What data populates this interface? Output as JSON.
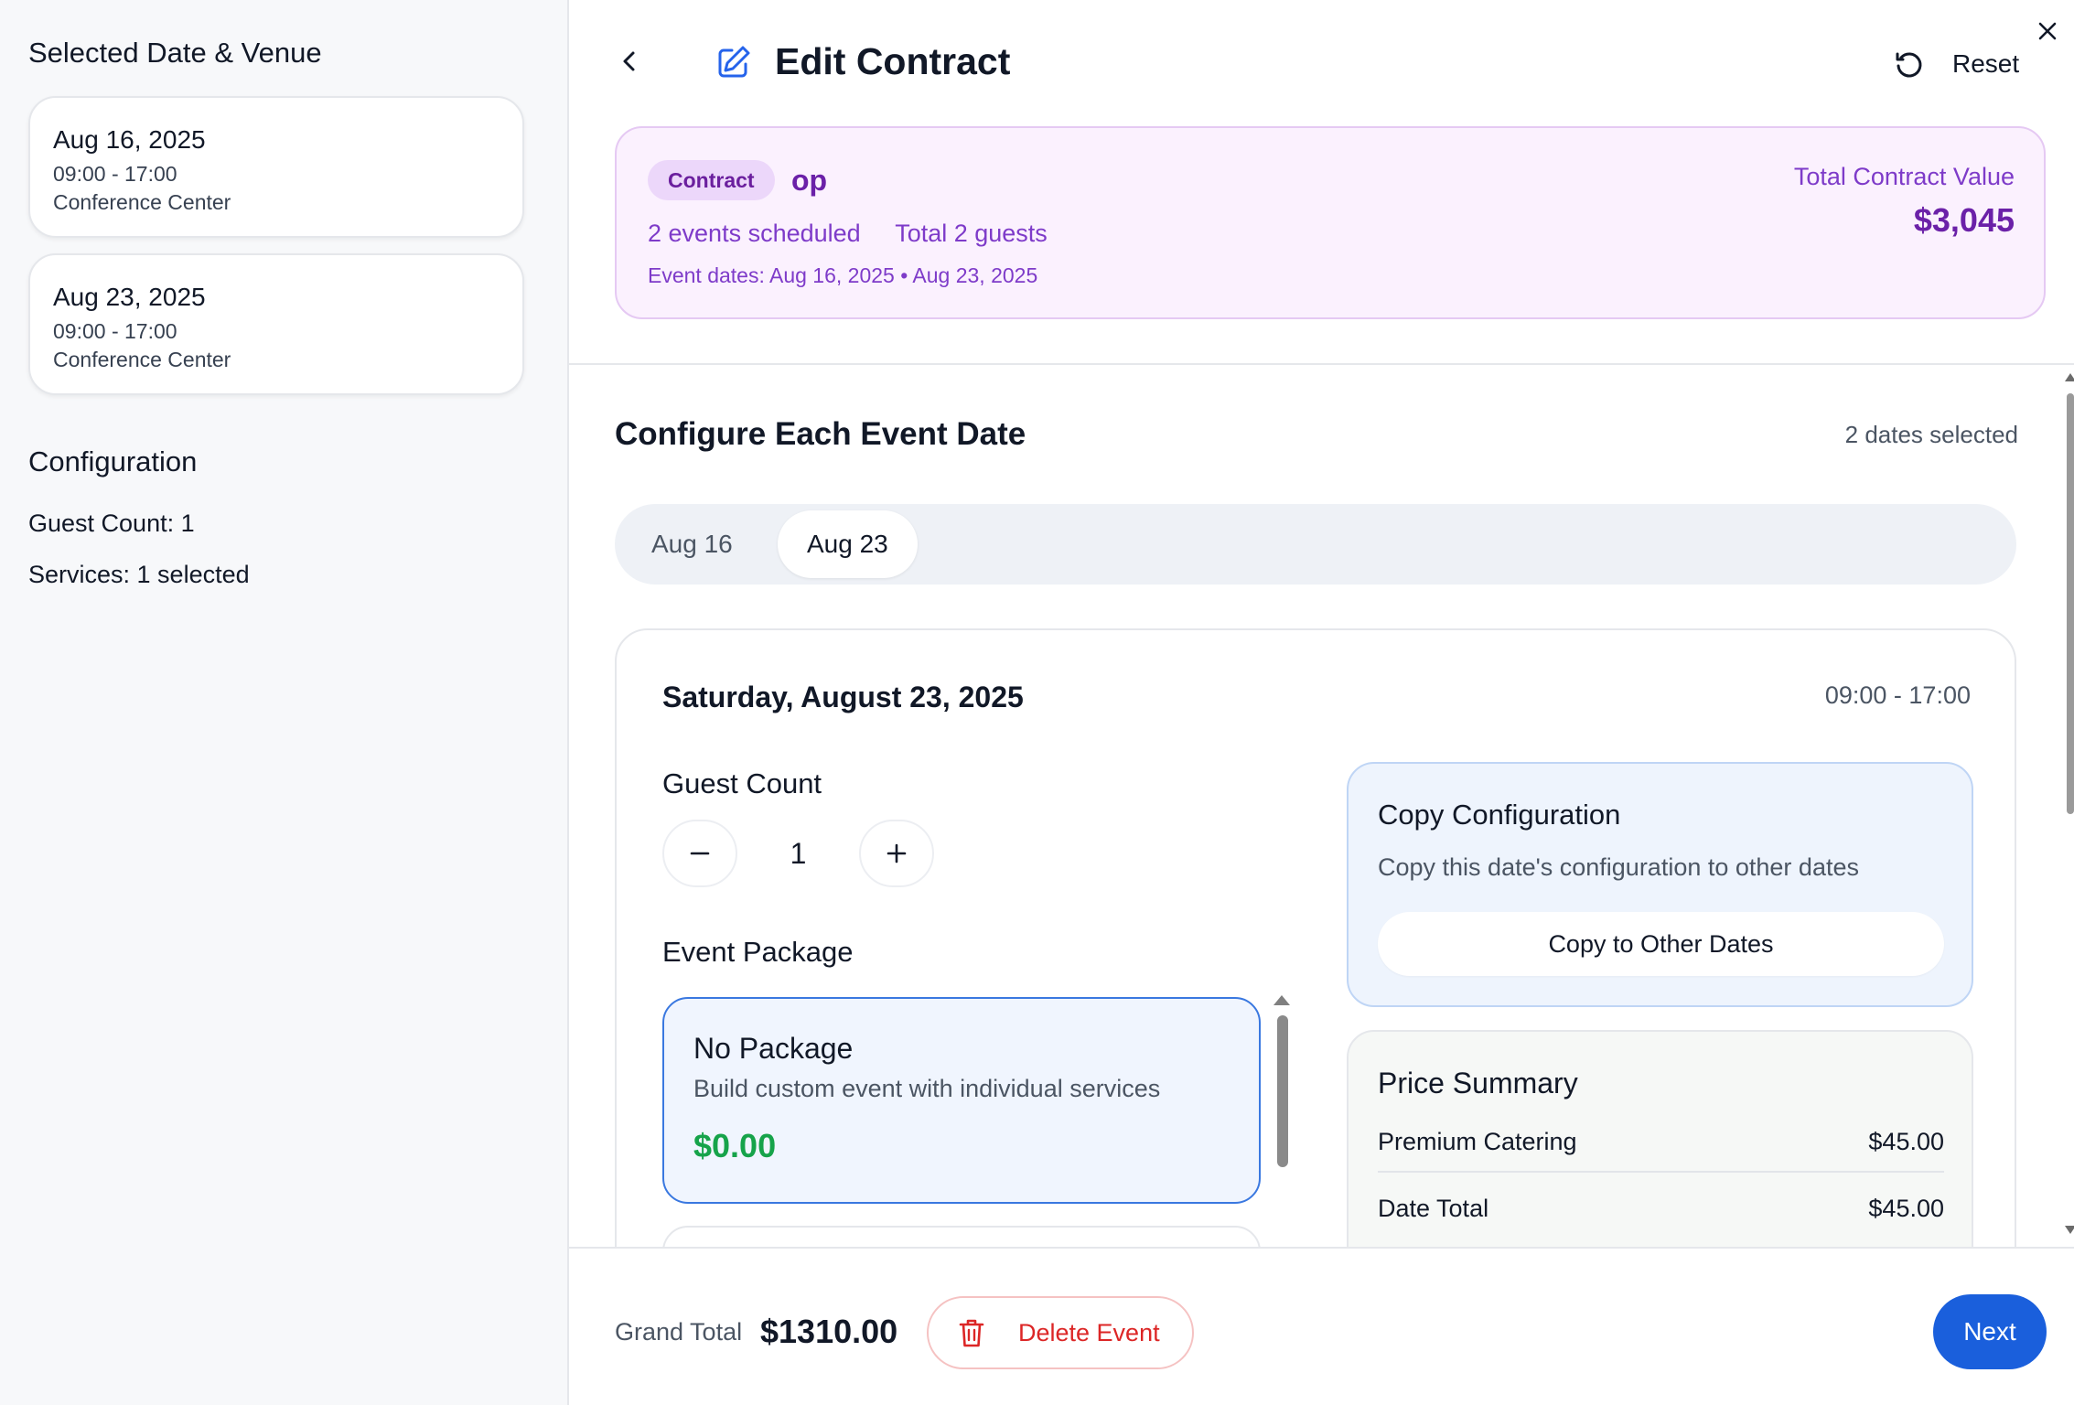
{
  "sidebar": {
    "title": "Selected Date & Venue",
    "dates": [
      {
        "date": "Aug 16, 2025",
        "time": "09:00 - 17:00",
        "venue": "Conference Center"
      },
      {
        "date": "Aug 23, 2025",
        "time": "09:00 - 17:00",
        "venue": "Conference Center"
      }
    ],
    "configuration_title": "Configuration",
    "guest_count": "Guest Count: 1",
    "services": "Services: 1 selected"
  },
  "header": {
    "title": "Edit Contract",
    "reset_label": "Reset",
    "icons": {
      "back": "chevron-left-icon",
      "edit": "edit-icon",
      "reset": "reset-icon",
      "close": "close-icon"
    }
  },
  "contract": {
    "badge": "Contract",
    "client": "op",
    "events_scheduled": "2 events scheduled",
    "total_guests": "Total 2 guests",
    "event_dates": "Event dates: Aug 16, 2025 • Aug 23, 2025",
    "total_value_label": "Total Contract Value",
    "total_value": "$3,045"
  },
  "configure": {
    "title": "Configure Each Event Date",
    "dates_selected": "2 dates selected",
    "tabs": [
      {
        "label": "Aug 16",
        "active": false
      },
      {
        "label": "Aug 23",
        "active": true
      }
    ]
  },
  "date_panel": {
    "date": "Saturday, August 23, 2025",
    "time": "09:00 - 17:00",
    "guest_count_label": "Guest Count",
    "guest_count_value": "1",
    "event_package_label": "Event Package",
    "packages": [
      {
        "name": "No Package",
        "description": "Build custom event with individual services",
        "price": "$0.00",
        "selected": true
      }
    ],
    "copy": {
      "title": "Copy Configuration",
      "description": "Copy this date's configuration to other dates",
      "button_label": "Copy to Other Dates"
    },
    "price_summary": {
      "title": "Price Summary",
      "rows": [
        {
          "label": "Premium Catering",
          "value": "$45.00"
        },
        {
          "label": "Date Total",
          "value": "$45.00"
        }
      ]
    }
  },
  "footer": {
    "grand_total_label": "Grand Total",
    "grand_total_value": "$1310.00",
    "delete_label": "Delete Event",
    "next_label": "Next"
  },
  "colors": {
    "accent_blue": "#1a5fdc",
    "purple": "#6b21a8",
    "price_green": "#16a34a",
    "danger_red": "#dc2626"
  }
}
